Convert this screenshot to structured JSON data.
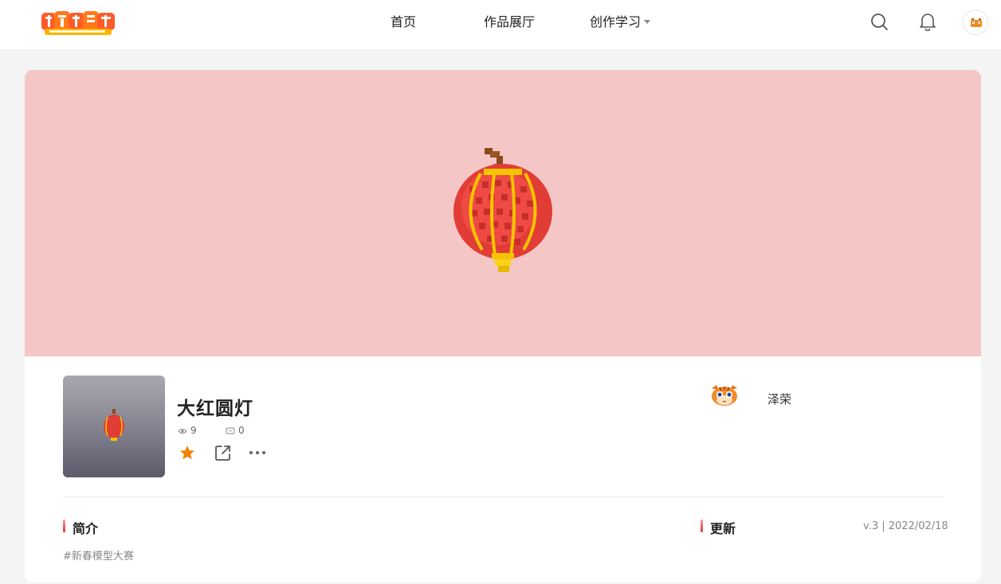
{
  "header": {
    "logo_alt": "神奇代码岛",
    "nav": {
      "home": "首页",
      "gallery": "作品展厅",
      "learn": "创作学习"
    },
    "icons": [
      "search-icon",
      "bell-icon",
      "avatar"
    ]
  },
  "work": {
    "title": "大红圆灯",
    "views": "9",
    "comments": "0",
    "actions": [
      "star-icon",
      "share-icon",
      "more-icon"
    ],
    "author": "泽荣",
    "banner_color": "#f5c6c6"
  },
  "sections": {
    "intro_title": "简介",
    "intro_tag": "#新春模型大赛",
    "update_title": "更新",
    "version_info": "v.3 | 2022/02/18"
  },
  "colors": {
    "accent": "#f08300",
    "lantern_red": "#e8413c",
    "lantern_gold": "#f5c400",
    "section_bar": "#e03030"
  }
}
